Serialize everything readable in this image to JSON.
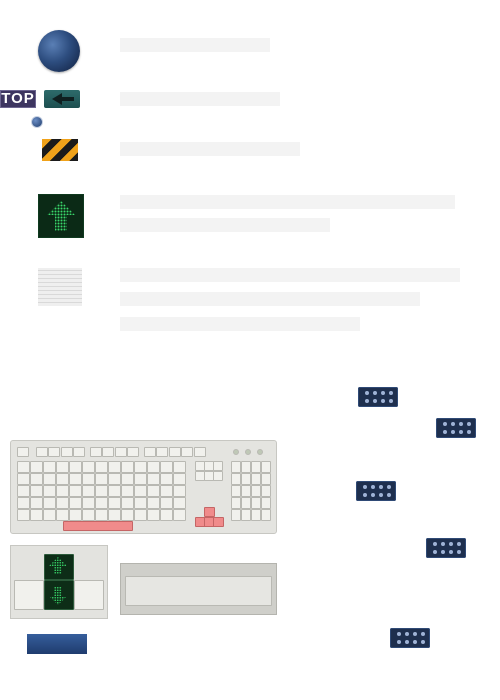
{
  "badges": {
    "top_label": "TOP"
  },
  "colors": {
    "orb": "#2d4d7f",
    "stripe_orange": "#f0a21a",
    "led_green": "#39d86b",
    "key_red": "#f08b8b",
    "button_navy": "#1e2f4e"
  },
  "icons": [
    "blue-orb-icon",
    "top-badge",
    "back-arrow-icon",
    "bullet-dot-icon",
    "hazard-stripes-icon",
    "green-up-arrow-icon",
    "paper-texture-icon",
    "dots-button-icon",
    "keyboard-image",
    "arrow-keys-image",
    "spacebar-image",
    "blue-bar-button"
  ]
}
